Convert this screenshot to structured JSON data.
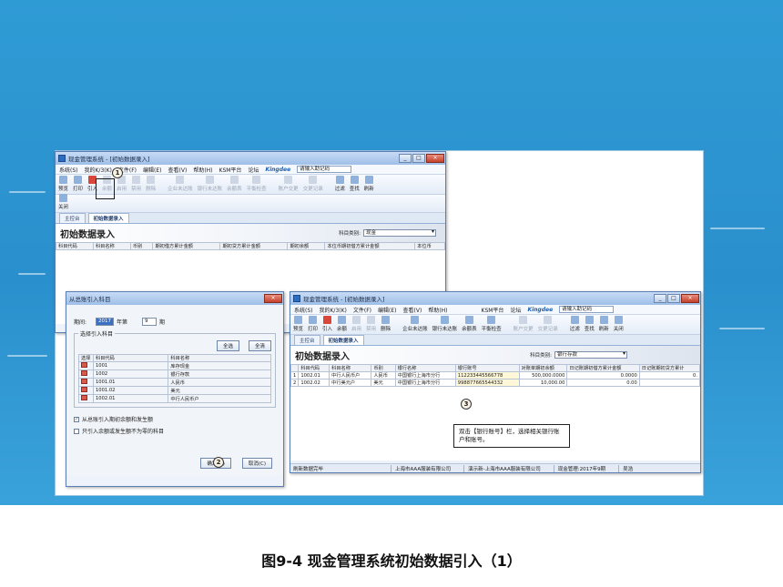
{
  "caption": "图9-4  现金管理系统初始数据引入（1）",
  "windows": {
    "main": {
      "title": "现金管理系统 - [初始数据录入]",
      "menu": [
        "系统(S)",
        "我的K/3(K)",
        "文件(F)",
        "编辑(E)",
        "查看(V)",
        "帮助(H)",
        "KSM平台",
        "论坛",
        "Kingdee",
        "请输入助记码"
      ],
      "toolbar": [
        "预览",
        "打印",
        "引入",
        "余额",
        "启用",
        "禁用",
        "删除",
        "企业未达账",
        "银行未达账",
        "余额表",
        "平衡检查",
        "账户交更",
        "交更记录",
        "过滤",
        "查找",
        "刷新"
      ],
      "close": "关闭",
      "tabs": [
        "主控台",
        "初始数据录入"
      ],
      "page_title": "初始数据录入",
      "category_label": "科目类别:",
      "category_value": "现金",
      "columns": [
        "科目代码",
        "科目名称",
        "币别",
        "期初借方累计金额",
        "期初贷方累计金额",
        "期初余额",
        "本位币期初借方累计金额",
        "本位币"
      ]
    },
    "dialog": {
      "title": "从总账引入科目",
      "period_label": "期间:",
      "year": "2017",
      "year_suffix": "年第",
      "month": "9",
      "month_suffix": "期",
      "group_label": "选择引入科目",
      "select_all": "全选",
      "clear_all": "全清",
      "columns": [
        "选择",
        "科目代码",
        "科目名称"
      ],
      "rows": [
        {
          "code": "1001",
          "name": "库存现金"
        },
        {
          "code": "1002",
          "name": "银行存款"
        },
        {
          "code": "1001.01",
          "name": "人民币"
        },
        {
          "code": "1001.02",
          "name": "美元"
        },
        {
          "code": "1002.01",
          "name": "中行人民币户"
        }
      ],
      "opt1": "从总账引入期初余额和发生额",
      "opt2": "只引入余额或发生额不为零的科目",
      "ok": "确定(O)",
      "cancel": "取消(C)"
    },
    "second": {
      "title": "现金管理系统 - [初始数据录入]",
      "menu": [
        "系统(S)",
        "我的K/3(K)",
        "文件(F)",
        "编辑(E)",
        "查看(V)",
        "帮助(H)",
        "KSM平台",
        "论坛",
        "Kingdee",
        "请输入助记码"
      ],
      "toolbar": [
        "预览",
        "打印",
        "引入",
        "余额",
        "启用",
        "禁用",
        "删除",
        "企业未达账",
        "银行未达账",
        "余额表",
        "平衡检查",
        "账户交更",
        "交更记录",
        "过滤",
        "查找",
        "刷新",
        "关闭"
      ],
      "tabs": [
        "主控台",
        "初始数据录入"
      ],
      "page_title": "初始数据录入",
      "category_label": "科目类别:",
      "category_value": "银行存款",
      "columns": [
        "",
        "科目代码",
        "科目名称",
        "币别",
        "银行名称",
        "银行账号",
        "对账单期初余额",
        "日记账期初借方累计金额",
        "日记账期初贷方累计"
      ],
      "rows": [
        {
          "idx": "1",
          "code": "1002.01",
          "name": "中行人民币户",
          "currency": "人民币",
          "bank": "中国银行上海市分行",
          "account": "112233445566778",
          "balance": "500,000.0000",
          "debit": "0.0000",
          "credit": "0."
        },
        {
          "idx": "2",
          "code": "1002.02",
          "name": "中行美元户",
          "currency": "美元",
          "bank": "中国银行上海市分行",
          "account": "998877665544332",
          "balance": "10,000.00",
          "debit": "0.00",
          "credit": ""
        }
      ],
      "status": [
        "刷新数据完毕",
        "上海市AAA服装有限公司",
        "演示新-上海市AAA服装有限公司",
        "现金管理:2017年9期",
        "吴浩"
      ]
    }
  },
  "callouts": [
    "1",
    "2",
    "3"
  ],
  "note": "双击【银行账号】栏，选择相关银行账户和账号。"
}
